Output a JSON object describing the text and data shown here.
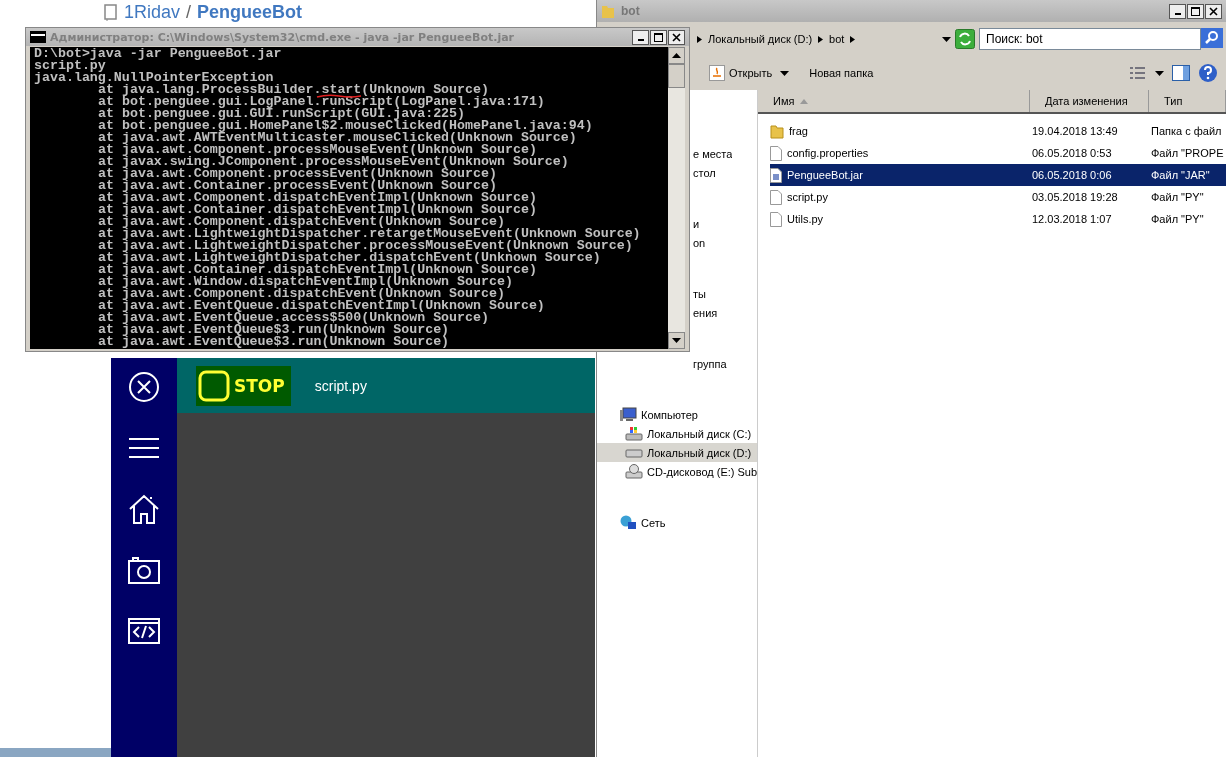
{
  "browser_page": {
    "owner": "1Ridav",
    "separator": "/",
    "repo": "PengueeBot"
  },
  "console_window": {
    "title": "Администратор: C:\\Windows\\System32\\cmd.exe - java  -jar PengueeBot.jar",
    "lines": [
      "D:\\bot>java -jar PengueeBot.jar",
      "script.py",
      "java.lang.NullPointerException"
    ],
    "stack_frames": [
      "at java.lang.ProcessBuilder.start(Unknown Source)",
      "at bot.penguee.gui.LogPanel.runScript(LogPanel.java:171)",
      "at bot.penguee.gui.GUI.runScript(GUI.java:225)",
      "at bot.penguee.gui.HomePanel$2.mouseClicked(HomePanel.java:94)",
      "at java.awt.AWTEventMulticaster.mouseClicked(Unknown Source)",
      "at java.awt.Component.processMouseEvent(Unknown Source)",
      "at javax.swing.JComponent.processMouseEvent(Unknown Source)",
      "at java.awt.Component.processEvent(Unknown Source)",
      "at java.awt.Container.processEvent(Unknown Source)",
      "at java.awt.Component.dispatchEventImpl(Unknown Source)",
      "at java.awt.Container.dispatchEventImpl(Unknown Source)",
      "at java.awt.Component.dispatchEvent(Unknown Source)",
      "at java.awt.LightweightDispatcher.retargetMouseEvent(Unknown Source)",
      "at java.awt.LightweightDispatcher.processMouseEvent(Unknown Source)",
      "at java.awt.LightweightDispatcher.dispatchEvent(Unknown Source)",
      "at java.awt.Container.dispatchEventImpl(Unknown Source)",
      "at java.awt.Window.dispatchEventImpl(Unknown Source)",
      "at java.awt.Component.dispatchEvent(Unknown Source)",
      "at java.awt.EventQueue.dispatchEventImpl(Unknown Source)",
      "at java.awt.EventQueue.access$500(Unknown Source)",
      "at java.awt.EventQueue$3.run(Unknown Source)",
      "at java.awt.EventQueue$3.run(Unknown Source)"
    ]
  },
  "explorer": {
    "title": "bot",
    "path": [
      "Локальный диск (D:)",
      "bot"
    ],
    "search_placeholder": "Поиск: bot",
    "toolbar": [
      "Открыть",
      "Новая папка"
    ],
    "nav_groups": [
      [
        {
          "label": "е места",
          "kind": "fragment",
          "selected": false
        },
        {
          "label": "стол",
          "kind": "fragment",
          "selected": false
        }
      ],
      [
        {
          "label": "и",
          "kind": "fragment",
          "selected": false
        },
        {
          "label": "on",
          "kind": "fragment",
          "selected": false
        }
      ],
      [
        {
          "label": "ты",
          "kind": "fragment",
          "selected": false
        },
        {
          "label": "ения",
          "kind": "fragment",
          "selected": false
        }
      ],
      [
        {
          "label": "группа",
          "kind": "fragment",
          "selected": false
        }
      ],
      [
        {
          "label": "Компьютер",
          "kind": "computer",
          "selected": false,
          "children": [
            {
              "label": "Локальный диск (C:)",
              "kind": "system-drive",
              "selected": false
            },
            {
              "label": "Локальный диск (D:)",
              "kind": "drive",
              "selected": true
            },
            {
              "label": "CD-дисковод (E:) Sub",
              "kind": "cd-drive",
              "selected": false
            }
          ]
        }
      ],
      [
        {
          "label": "Сеть",
          "kind": "network",
          "selected": false
        }
      ]
    ],
    "columns": [
      "Имя",
      "Дата изменения",
      "Тип"
    ],
    "files": [
      {
        "name": "frag",
        "date": "19.04.2018 13:49",
        "type": "Папка с файл",
        "kind": "folder",
        "selected": false
      },
      {
        "name": "config.properties",
        "date": "06.05.2018 0:53",
        "type": "Файл \"PROPE",
        "kind": "file",
        "selected": false
      },
      {
        "name": "PengueeBot.jar",
        "date": "06.05.2018 0:06",
        "type": "Файл \"JAR\"",
        "kind": "jar",
        "selected": true
      },
      {
        "name": "script.py",
        "date": "03.05.2018 19:28",
        "type": "Файл \"PY\"",
        "kind": "file",
        "selected": false
      },
      {
        "name": "Utils.py",
        "date": "12.03.2018 1:07",
        "type": "Файл \"PY\"",
        "kind": "file",
        "selected": false
      }
    ]
  },
  "app": {
    "stop_label": "STOP",
    "script": "script.py"
  }
}
